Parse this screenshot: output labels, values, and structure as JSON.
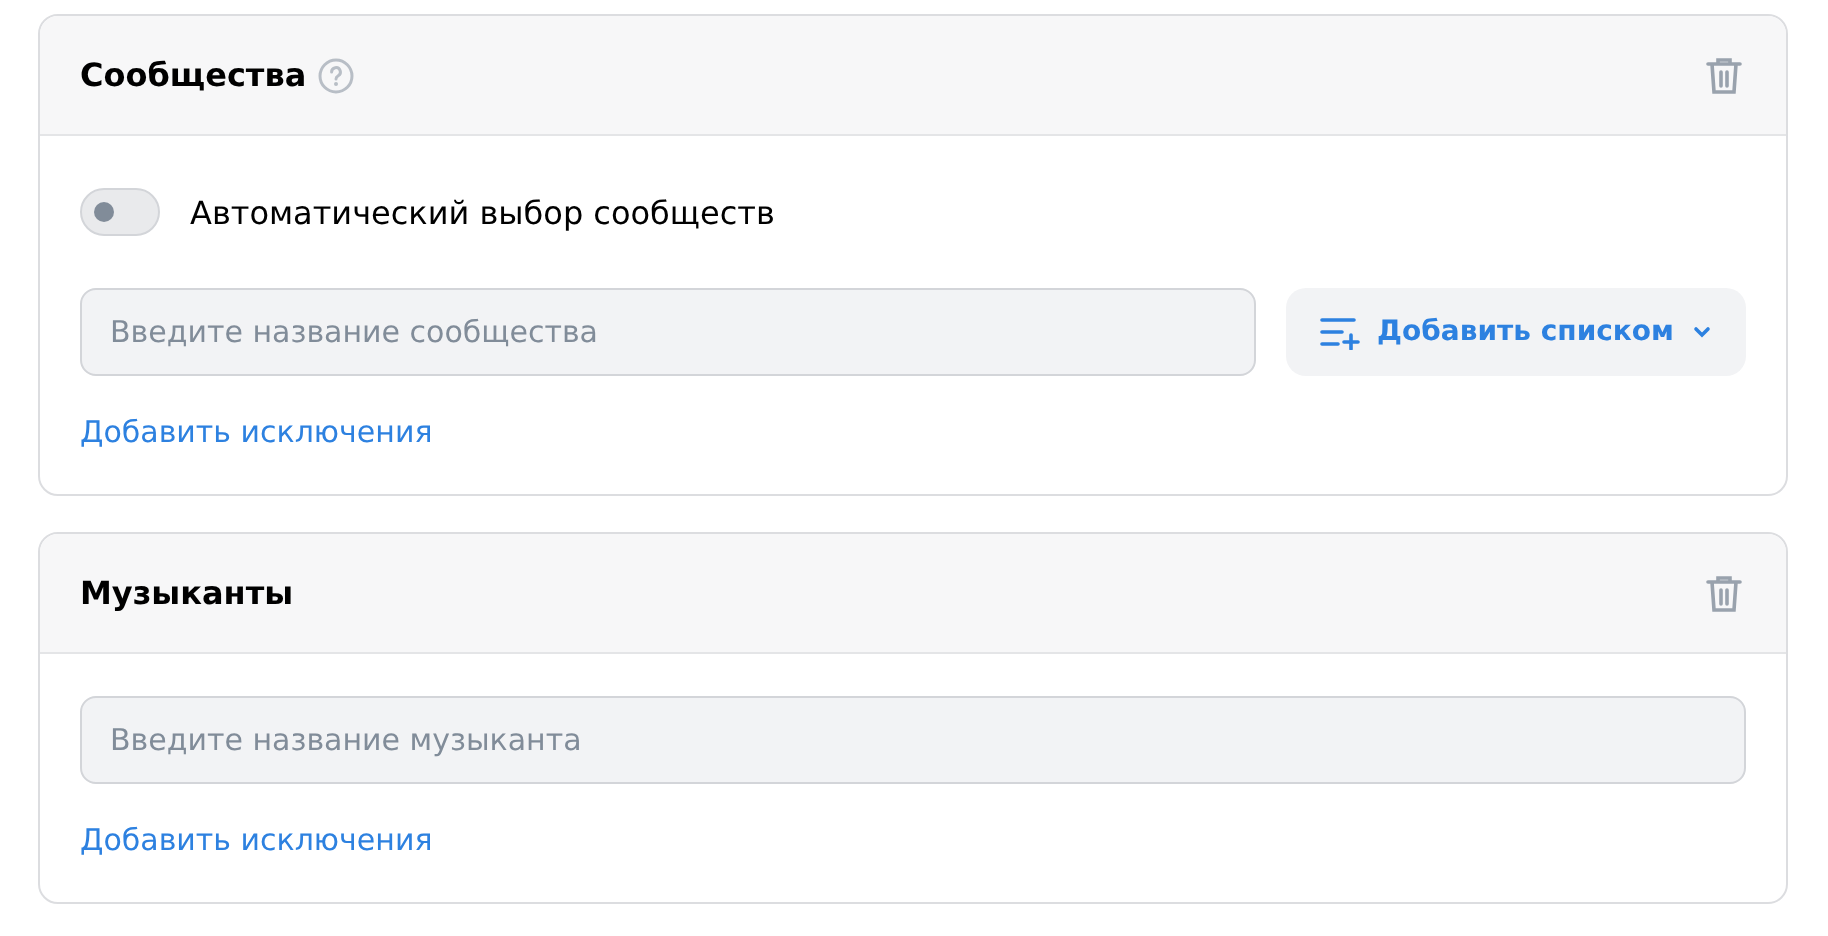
{
  "sections": [
    {
      "title": "Сообщества",
      "help": true,
      "toggle": {
        "label": "Автоматический выбор сообществ",
        "on": false
      },
      "field": {
        "placeholder": "Введите название сообщества"
      },
      "list_button": {
        "label": "Добавить списком"
      },
      "link": "Добавить исключения"
    },
    {
      "title": "Музыканты",
      "help": false,
      "field": {
        "placeholder": "Введите название музыканта"
      },
      "link": "Добавить исключения"
    }
  ]
}
